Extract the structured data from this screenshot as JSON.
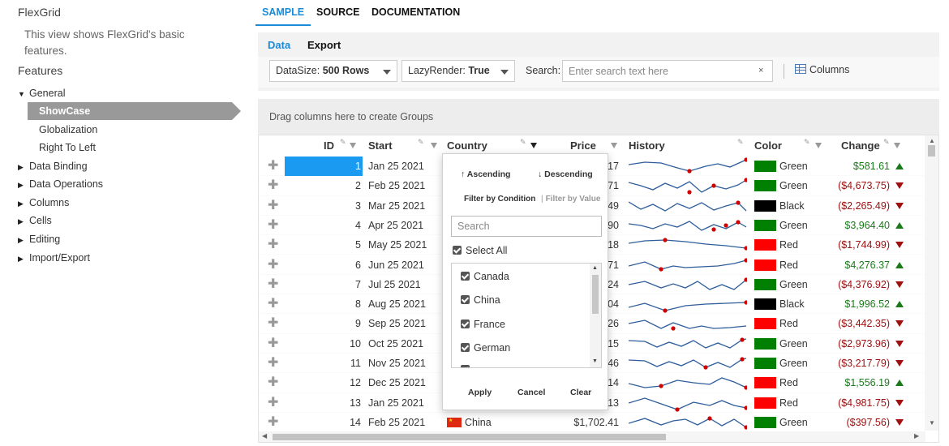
{
  "app": {
    "title": "FlexGrid",
    "description": "This view shows FlexGrid's basic features.",
    "features_heading": "Features"
  },
  "nav": {
    "general": "General",
    "selected": "ShowCase",
    "children": [
      "Globalization",
      "Right To Left"
    ],
    "collapsed": [
      "Data Binding",
      "Data Operations",
      "Columns",
      "Cells",
      "Editing",
      "Import/Export"
    ]
  },
  "top_tabs": [
    "SAMPLE",
    "SOURCE",
    "DOCUMENTATION"
  ],
  "sub_tabs": [
    "Data",
    "Export"
  ],
  "toolbar": {
    "datasize_label": "DataSize:",
    "datasize_value": "500 Rows",
    "lazy_label": "LazyRender:",
    "lazy_value": "True",
    "search_label": "Search:",
    "search_placeholder": "Enter search text here",
    "search_clear": "×",
    "columns_label": "Columns"
  },
  "group_panel_text": "Drag columns here to create Groups",
  "columns": [
    "ID",
    "Start",
    "Country",
    "Price",
    "History",
    "Color",
    "Change"
  ],
  "rows": [
    {
      "id": "1",
      "start": "Jan 25 2021",
      "price_tail": "17",
      "color": "Green",
      "swatch": "#008000",
      "change": "$581.61",
      "dir": "up"
    },
    {
      "id": "2",
      "start": "Feb 25 2021",
      "price_tail": "71",
      "color": "Green",
      "swatch": "#008000",
      "change": "($4,673.75)",
      "dir": "down"
    },
    {
      "id": "3",
      "start": "Mar 25 2021",
      "price_tail": "49",
      "color": "Black",
      "swatch": "#000000",
      "change": "($2,265.49)",
      "dir": "down"
    },
    {
      "id": "4",
      "start": "Apr 25 2021",
      "price_tail": "90",
      "color": "Green",
      "swatch": "#008000",
      "change": "$3,964.40",
      "dir": "up"
    },
    {
      "id": "5",
      "start": "May 25 2021",
      "price_tail": "18",
      "color": "Red",
      "swatch": "#ff0000",
      "change": "($1,744.99)",
      "dir": "down"
    },
    {
      "id": "6",
      "start": "Jun 25 2021",
      "price_tail": "71",
      "color": "Red",
      "swatch": "#ff0000",
      "change": "$4,276.37",
      "dir": "up"
    },
    {
      "id": "7",
      "start": "Jul 25 2021",
      "price_tail": "24",
      "color": "Green",
      "swatch": "#008000",
      "change": "($4,376.92)",
      "dir": "down"
    },
    {
      "id": "8",
      "start": "Aug 25 2021",
      "price_tail": "04",
      "color": "Black",
      "swatch": "#000000",
      "change": "$1,996.52",
      "dir": "up"
    },
    {
      "id": "9",
      "start": "Sep 25 2021",
      "price_tail": "26",
      "color": "Red",
      "swatch": "#ff0000",
      "change": "($3,442.35)",
      "dir": "down"
    },
    {
      "id": "10",
      "start": "Oct 25 2021",
      "price_tail": "15",
      "color": "Green",
      "swatch": "#008000",
      "change": "($2,973.96)",
      "dir": "down"
    },
    {
      "id": "11",
      "start": "Nov 25 2021",
      "price_tail": "46",
      "color": "Green",
      "swatch": "#008000",
      "change": "($3,217.79)",
      "dir": "down"
    },
    {
      "id": "12",
      "start": "Dec 25 2021",
      "price_tail": "14",
      "color": "Red",
      "swatch": "#ff0000",
      "change": "$1,556.19",
      "dir": "up"
    },
    {
      "id": "13",
      "start": "Jan 25 2021",
      "price_tail": "13",
      "color": "Red",
      "swatch": "#ff0000",
      "change": "($4,981.75)",
      "dir": "down"
    },
    {
      "id": "14",
      "start": "Feb 25 2021",
      "country": "China",
      "price": "$1,702.41",
      "color": "Green",
      "swatch": "#008000",
      "change": "($397.56)",
      "dir": "down"
    }
  ],
  "filter": {
    "ascending": "↑ Ascending",
    "descending": "↓ Descending",
    "by_condition": "Filter by Condition",
    "by_value": "Filter by Value",
    "search_placeholder": "Search",
    "select_all": "Select All",
    "values": [
      "Canada",
      "China",
      "France",
      "German"
    ],
    "apply": "Apply",
    "cancel": "Cancel",
    "clear": "Clear"
  },
  "colors": {
    "accent": "#1b8bd6",
    "selected_cell": "#1a9af0",
    "positive": "#1a7a1a",
    "negative": "#a01010",
    "sparkline": "#2d5d9c",
    "spark_marker": "#d00000"
  }
}
